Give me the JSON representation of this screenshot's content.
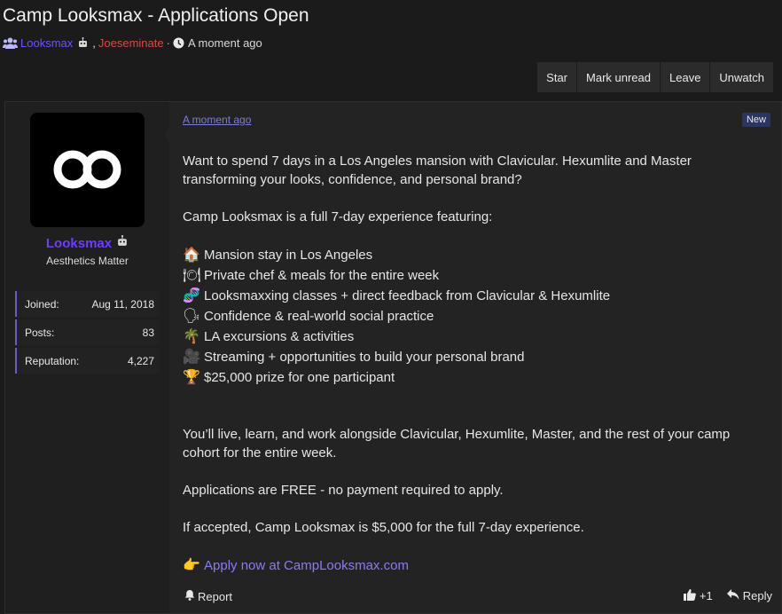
{
  "thread": {
    "title": "Camp Looksmax - Applications Open",
    "participant1": "Looksmax",
    "participant_sep": ",",
    "participant2": "Joeseminate",
    "dot": "·",
    "time": "A moment ago"
  },
  "toolbar": {
    "star": "Star",
    "mark_unread": "Mark unread",
    "leave": "Leave",
    "unwatch": "Unwatch"
  },
  "user": {
    "name": "Looksmax",
    "title": "Aesthetics Matter",
    "stats": [
      {
        "label": "Joined:",
        "value": "Aug 11, 2018"
      },
      {
        "label": "Posts:",
        "value": "83"
      },
      {
        "label": "Reputation:",
        "value": "4,227"
      }
    ]
  },
  "post": {
    "timestamp": "A moment ago",
    "badge": "New",
    "intro": "Want to spend 7 days in a Los Angeles mansion with Clavicular. Hexumlite and Master transforming your looks, confidence, and personal brand?",
    "lead": "Camp Looksmax is a full 7-day experience featuring:",
    "features": [
      {
        "emoji": "🏠",
        "text": "Mansion stay in Los Angeles"
      },
      {
        "emoji": "🍽",
        "text": "Private chef & meals for the entire week"
      },
      {
        "emoji": "🧬",
        "text": "Looksmaxxing classes + direct feedback from Clavicular & Hexumlite"
      },
      {
        "emoji": "🗣",
        "text": "Confidence & real-world social practice"
      },
      {
        "emoji": "🌴",
        "text": "LA excursions & activities"
      },
      {
        "emoji": "🎥",
        "text": "Streaming + opportunities to build your personal brand"
      },
      {
        "emoji": "🏆",
        "text": "$25,000 prize for one participant"
      }
    ],
    "live": "You’ll live, learn, and work alongside Clavicular, Hexumlite, Master, and the rest of your camp cohort for the entire week.",
    "free": "Applications are FREE - no payment required to apply.",
    "cost": "If accepted, Camp Looksmax is $5,000 for the full 7-day experience.",
    "apply_emoji": "👉",
    "apply_link": "Apply now at CampLooksmax.com"
  },
  "footer": {
    "report": "Report",
    "likes": "+1",
    "reply": "Reply"
  },
  "colors": {
    "background": "#1b1b1b",
    "post_bg": "#232323",
    "username": "#6f3cff",
    "participant2": "#e0483e",
    "link": "#8a7cf0",
    "badge": "#2c3560"
  }
}
